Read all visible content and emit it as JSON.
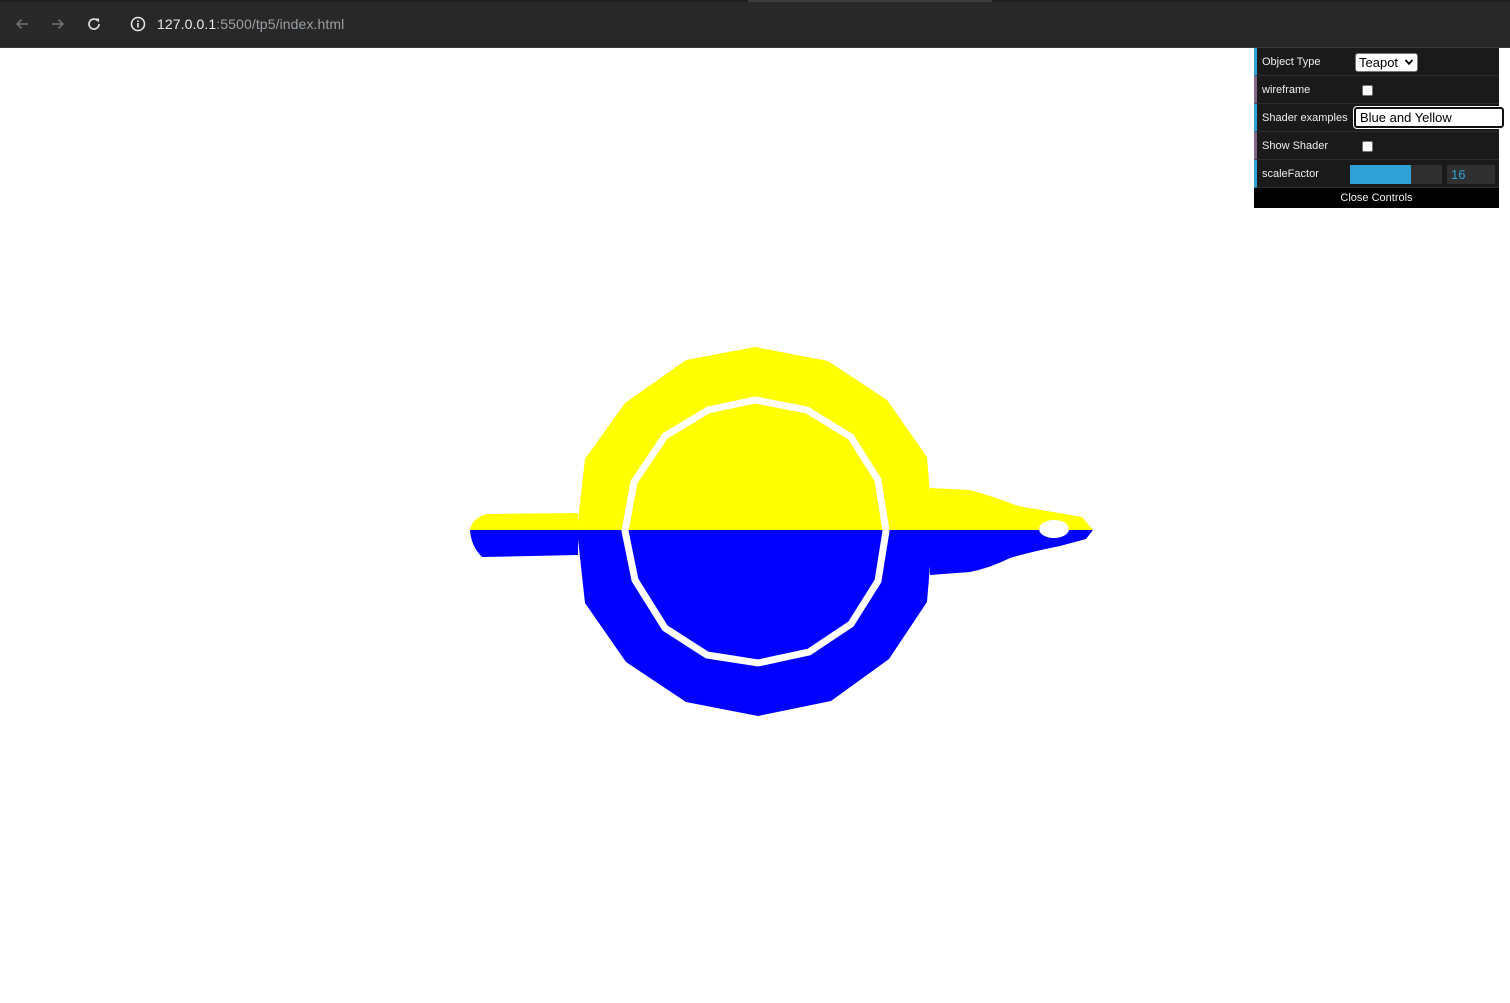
{
  "browser": {
    "url_host": "127.0.0.1",
    "url_rest": ":5500/tp5/index.html",
    "back_icon": "arrow-left-icon",
    "forward_icon": "arrow-right-icon",
    "reload_icon": "reload-icon",
    "site_info_icon": "info-icon"
  },
  "scene": {
    "object": "teapot",
    "top_color": "#ffff00",
    "bottom_color": "#0000ff",
    "background": "#ffffff"
  },
  "gui": {
    "object_type": {
      "label": "Object Type",
      "value": "Teapot"
    },
    "wireframe": {
      "label": "wireframe",
      "checked": false
    },
    "shader_examples": {
      "label": "Shader examples",
      "value": "Blue and Yellow"
    },
    "show_shader": {
      "label": "Show Shader",
      "checked": false
    },
    "scale_factor": {
      "label": "scaleFactor",
      "value": "16",
      "fill_fraction": 0.66
    },
    "close_label": "Close Controls",
    "accent_color": "#2fa1d6"
  }
}
